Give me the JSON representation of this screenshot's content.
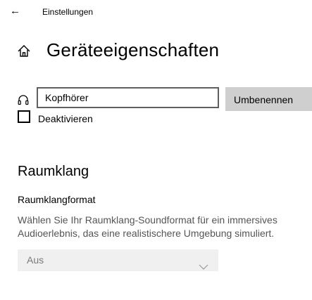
{
  "titlebar": {
    "title": "Einstellungen",
    "back_icon": "back-arrow-icon"
  },
  "page": {
    "title": "Geräteeigenschaften",
    "icon": "home-icon"
  },
  "device": {
    "icon": "headphones-icon",
    "name_value": "Kopfhörer",
    "rename_label": "Umbenennen"
  },
  "disable": {
    "label": "Deaktivieren",
    "checked": false
  },
  "spatial": {
    "section_title": "Raumklang",
    "format_title": "Raumklangformat",
    "description": "Wählen Sie Ihr Raumklang-Soundformat für ein immersives Audioerlebnis, das eine realistischere Umgebung simuliert.",
    "dropdown_value": "Aus",
    "dropdown_disabled": true
  }
}
